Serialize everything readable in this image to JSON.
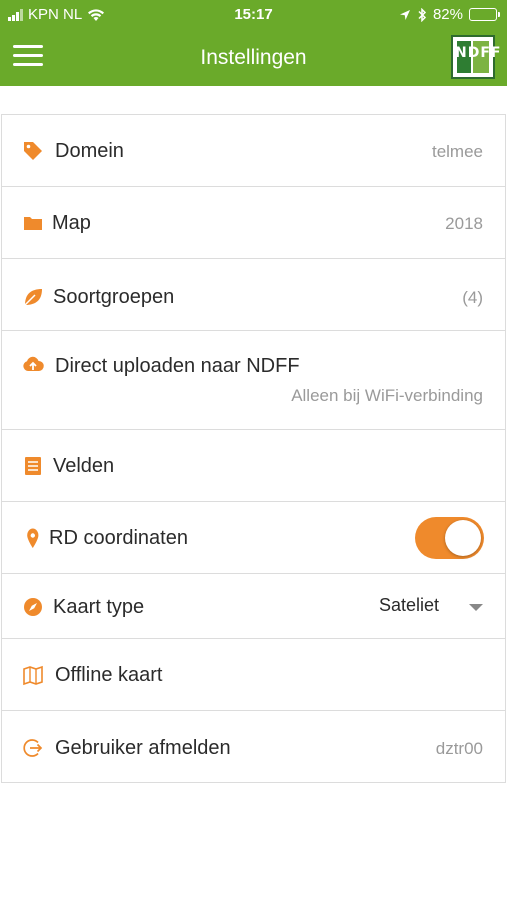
{
  "status_bar": {
    "carrier": "KPN NL",
    "time": "15:17",
    "battery_percent": "82%",
    "battery_level": 0.82
  },
  "nav": {
    "title": "Instellingen",
    "logo_text": "NDFF"
  },
  "settings": [
    {
      "label": "Domein",
      "value": "telmee",
      "icon": "tag-icon"
    },
    {
      "label": "Map",
      "value": "2018",
      "icon": "folder-icon"
    },
    {
      "label": "Soortgroepen",
      "value": "(4)",
      "icon": "leaf-icon"
    },
    {
      "label": "Direct uploaden naar NDFF",
      "value": "Alleen bij WiFi-verbinding",
      "icon": "cloud-upload-icon"
    },
    {
      "label": "Velden",
      "value": "",
      "icon": "list-icon"
    },
    {
      "label": "RD coordinaten",
      "value": "",
      "icon": "map-marker-icon",
      "toggle_on": true
    },
    {
      "label": "Kaart type",
      "value": "Sateliet",
      "icon": "compass-icon"
    },
    {
      "label": "Offline kaart",
      "value": "",
      "icon": "map-icon"
    },
    {
      "label": "Gebruiker afmelden",
      "value": "dztr00",
      "icon": "sign-out-icon"
    }
  ],
  "colors": {
    "brand_green": "#6aaa2a",
    "accent_orange": "#ef8a2c"
  }
}
